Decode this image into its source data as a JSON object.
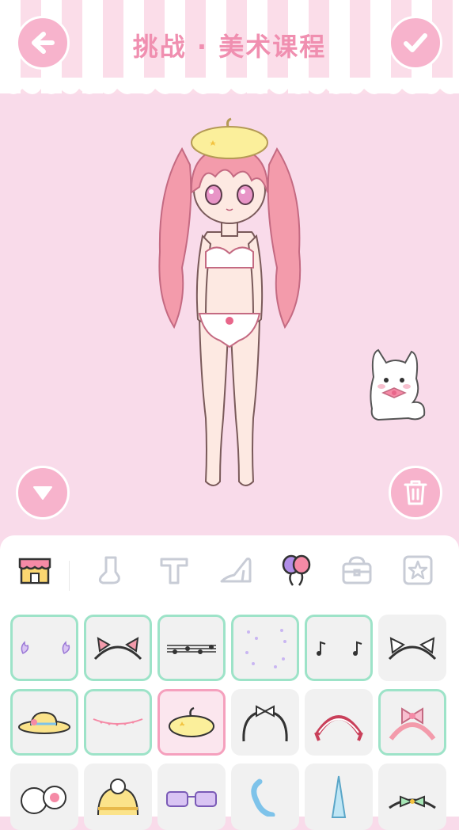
{
  "header": {
    "title": "挑战 · 美术课程",
    "back_icon": "arrow-left-icon",
    "confirm_icon": "checkmark-icon"
  },
  "stage": {
    "collapse_icon": "triangle-down-icon",
    "trash_icon": "trash-can-icon",
    "pet": "white-cat-with-bow"
  },
  "category_tabs": [
    {
      "id": "shop",
      "icon": "shop-icon",
      "active": true
    },
    {
      "id": "socks",
      "icon": "sock-icon"
    },
    {
      "id": "text",
      "icon": "text-t-icon"
    },
    {
      "id": "shoes",
      "icon": "high-heel-icon"
    },
    {
      "id": "accessories",
      "icon": "balloons-icon",
      "selected": true
    },
    {
      "id": "bags",
      "icon": "handbag-icon"
    },
    {
      "id": "favorites",
      "icon": "star-icon"
    }
  ],
  "items": [
    {
      "id": "purple-flame-clips",
      "owned": true
    },
    {
      "id": "cat-ear-headband-pink",
      "owned": true
    },
    {
      "id": "music-notes-headband",
      "owned": true
    },
    {
      "id": "sparkle-dots",
      "owned": true
    },
    {
      "id": "music-note-clips",
      "owned": true
    },
    {
      "id": "cat-ear-headband-white",
      "owned": false
    },
    {
      "id": "straw-hat-flower",
      "owned": true
    },
    {
      "id": "happy-birthday-banner",
      "owned": true
    },
    {
      "id": "yellow-beret",
      "owned": true,
      "selected": true
    },
    {
      "id": "bow-headband-black",
      "owned": false
    },
    {
      "id": "frilly-maid-headband",
      "owned": false
    },
    {
      "id": "pink-bow-headband",
      "owned": true
    },
    {
      "id": "paw-fluffy-earmuff",
      "owned": false
    },
    {
      "id": "yellow-knit-beanie",
      "owned": false
    },
    {
      "id": "purple-glasses",
      "owned": false
    },
    {
      "id": "blue-ribbon",
      "owned": false
    },
    {
      "id": "blue-unicorn-horn",
      "owned": false
    },
    {
      "id": "green-bow-tiara",
      "owned": false
    }
  ],
  "colors": {
    "pink_bg": "#f9dbea",
    "button_pink": "#f7b3cc",
    "owned_border": "#9de3c8",
    "selected_border": "#f5a0bd"
  }
}
